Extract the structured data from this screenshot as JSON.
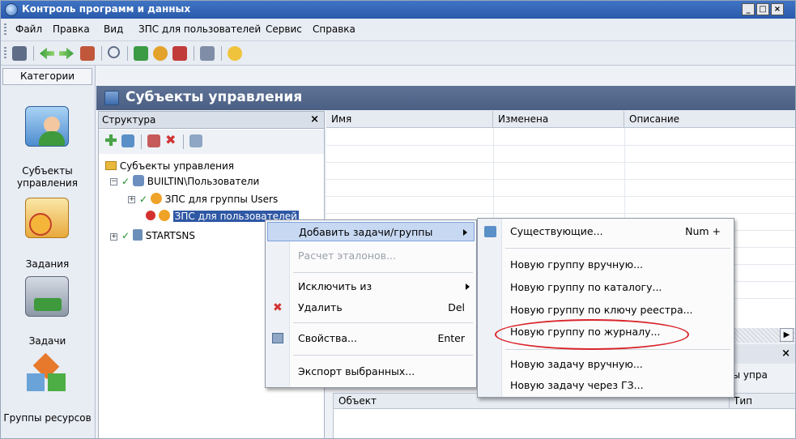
{
  "window": {
    "title": "Контроль программ и данных"
  },
  "menubar": [
    {
      "label": "Файл"
    },
    {
      "label": "Правка"
    },
    {
      "label": "Вид"
    },
    {
      "label": "ЗПС для пользователей"
    },
    {
      "label": "Сервис"
    },
    {
      "label": "Справка"
    }
  ],
  "categories": {
    "header": "Категории",
    "items": [
      {
        "label": "Субъекты управления",
        "icon": "user-computer-icon"
      },
      {
        "label": "Задания",
        "icon": "clock-document-icon"
      },
      {
        "label": "Задачи",
        "icon": "printer-user-icon"
      },
      {
        "label": "Группы ресурсов",
        "icon": "cubes-icon"
      }
    ]
  },
  "content": {
    "title": "Субъекты управления"
  },
  "structure": {
    "header": "Структура",
    "tree": {
      "root": "Субъекты управления",
      "builtin": "BUILTIN\\Пользователи",
      "child1": "ЗПС для группы Users",
      "child2": "ЗПС для пользователей",
      "startsns": "STARTSNS"
    }
  },
  "table": {
    "columns": [
      "Имя",
      "Изменена",
      "Описание"
    ]
  },
  "lower": {
    "tab_fragment": "екты упра",
    "columns": [
      "Объект",
      "Тип"
    ]
  },
  "context_menu": {
    "items": [
      {
        "label": "Добавить задачи/группы",
        "highlighted": true,
        "submenu": true
      },
      {
        "label": "Расчет эталонов...",
        "disabled": true
      },
      {
        "label": "Исключить из",
        "submenu": true
      },
      {
        "label": "Удалить",
        "shortcut": "Del"
      },
      {
        "label": "Свойства...",
        "shortcut": "Enter"
      },
      {
        "label": "Экспорт выбранных..."
      }
    ]
  },
  "submenu": {
    "items": [
      {
        "label": "Существующие...",
        "shortcut": "Num +"
      },
      {
        "label": "Новую группу вручную..."
      },
      {
        "label": "Новую группу по каталогу..."
      },
      {
        "label": "Новую группу по ключу реестра..."
      },
      {
        "label": "Новую группу по журналу..."
      },
      {
        "label": "Новую задачу вручную..."
      },
      {
        "label": "Новую задачу через ГЗ..."
      }
    ]
  },
  "colors": {
    "titlebar": "#2a5aab",
    "selection": "#2f58a5",
    "highlight_ellipse": "#d9252a"
  }
}
